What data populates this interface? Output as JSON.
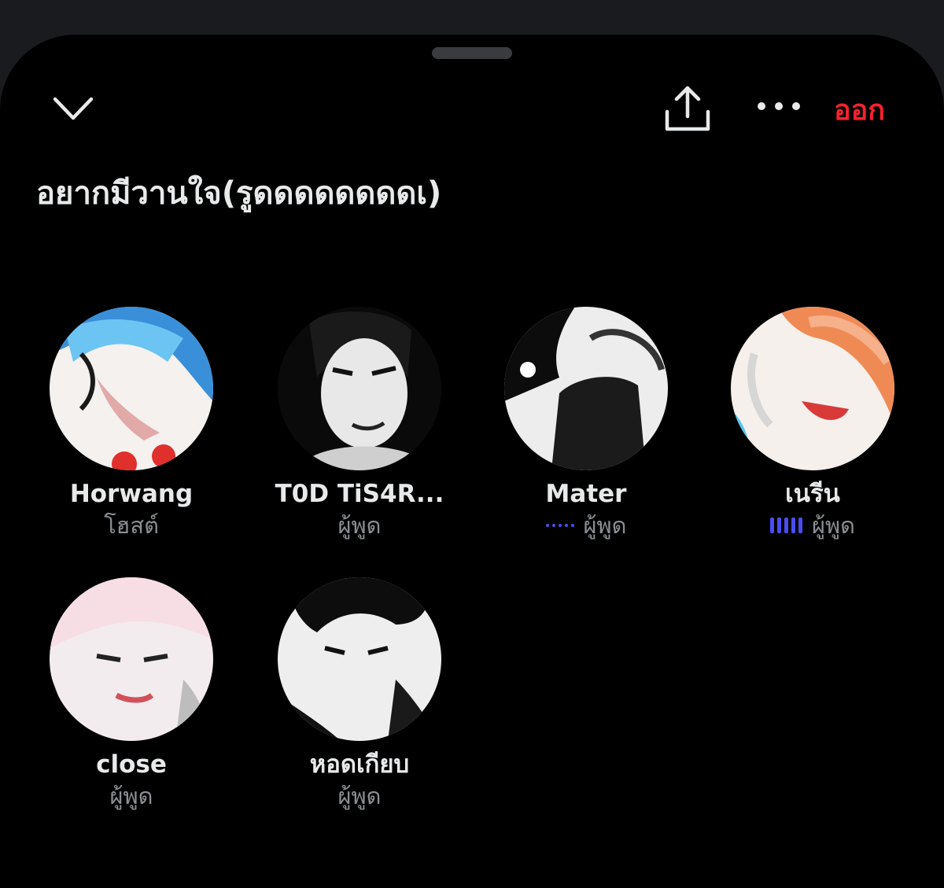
{
  "header": {
    "collapse_icon": "chevron-down-icon",
    "share_icon": "share-icon",
    "more_icon": "more-dots-icon",
    "leave_label": "ออก",
    "leave_color": "#f4212e"
  },
  "space": {
    "title": "อยากมีวานใจ(รูดดดดดดดดเ)"
  },
  "participants": [
    {
      "name": "Horwang",
      "role": "โฮสต์",
      "speaking_indicator": "none"
    },
    {
      "name": "T0D TiS4R...",
      "role": "ผู้พูด",
      "speaking_indicator": "none"
    },
    {
      "name": "Mater",
      "role": "ผู้พูด",
      "speaking_indicator": "dots"
    },
    {
      "name": "เนรีน",
      "role": "ผู้พูด",
      "speaking_indicator": "bars"
    },
    {
      "name": "close",
      "role": "ผู้พูด",
      "speaking_indicator": "none"
    },
    {
      "name": "หอดเกียบ",
      "role": "ผู้พูด",
      "speaking_indicator": "none"
    }
  ],
  "colors": {
    "background": "#000000",
    "accent_speaking": "#4b4cf0",
    "text_primary": "#e7e9ea",
    "text_secondary": "#8b8f94"
  }
}
